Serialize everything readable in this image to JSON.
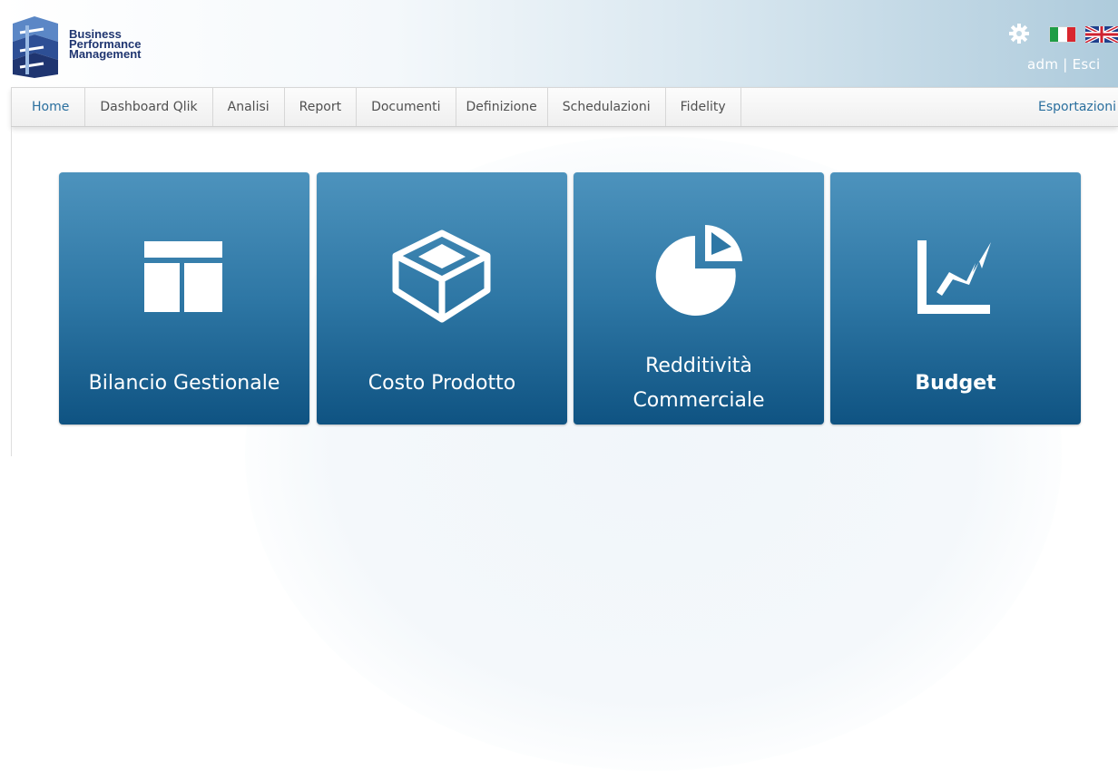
{
  "header": {
    "logo_text": [
      "Business",
      "Performance",
      "Management"
    ],
    "user": "adm",
    "separator": "|",
    "logout_label": "Esci",
    "languages": [
      "italian-flag",
      "uk-flag"
    ]
  },
  "nav": {
    "items": [
      {
        "label": "Home",
        "active": true
      },
      {
        "label": "Dashboard Qlik"
      },
      {
        "label": "Analisi"
      },
      {
        "label": "Report"
      },
      {
        "label": "Documenti"
      },
      {
        "label": "Definizione"
      },
      {
        "label": "Schedulazioni"
      },
      {
        "label": "Fidelity"
      }
    ],
    "right_label": "Esportazioni"
  },
  "tiles": [
    {
      "label": "Bilancio Gestionale",
      "icon": "table-layout-icon"
    },
    {
      "label": "Costo Prodotto",
      "icon": "box-icon"
    },
    {
      "label_line1": "Redditività",
      "label_line2": "Commerciale",
      "icon": "pie-chart-icon"
    },
    {
      "label": "Budget",
      "icon": "trend-chart-icon"
    }
  ],
  "colors": {
    "tile_top": "#4d93bd",
    "tile_bottom": "#0f5382",
    "nav_active": "#2a6f9e",
    "logo_blue": "#1f3570"
  }
}
